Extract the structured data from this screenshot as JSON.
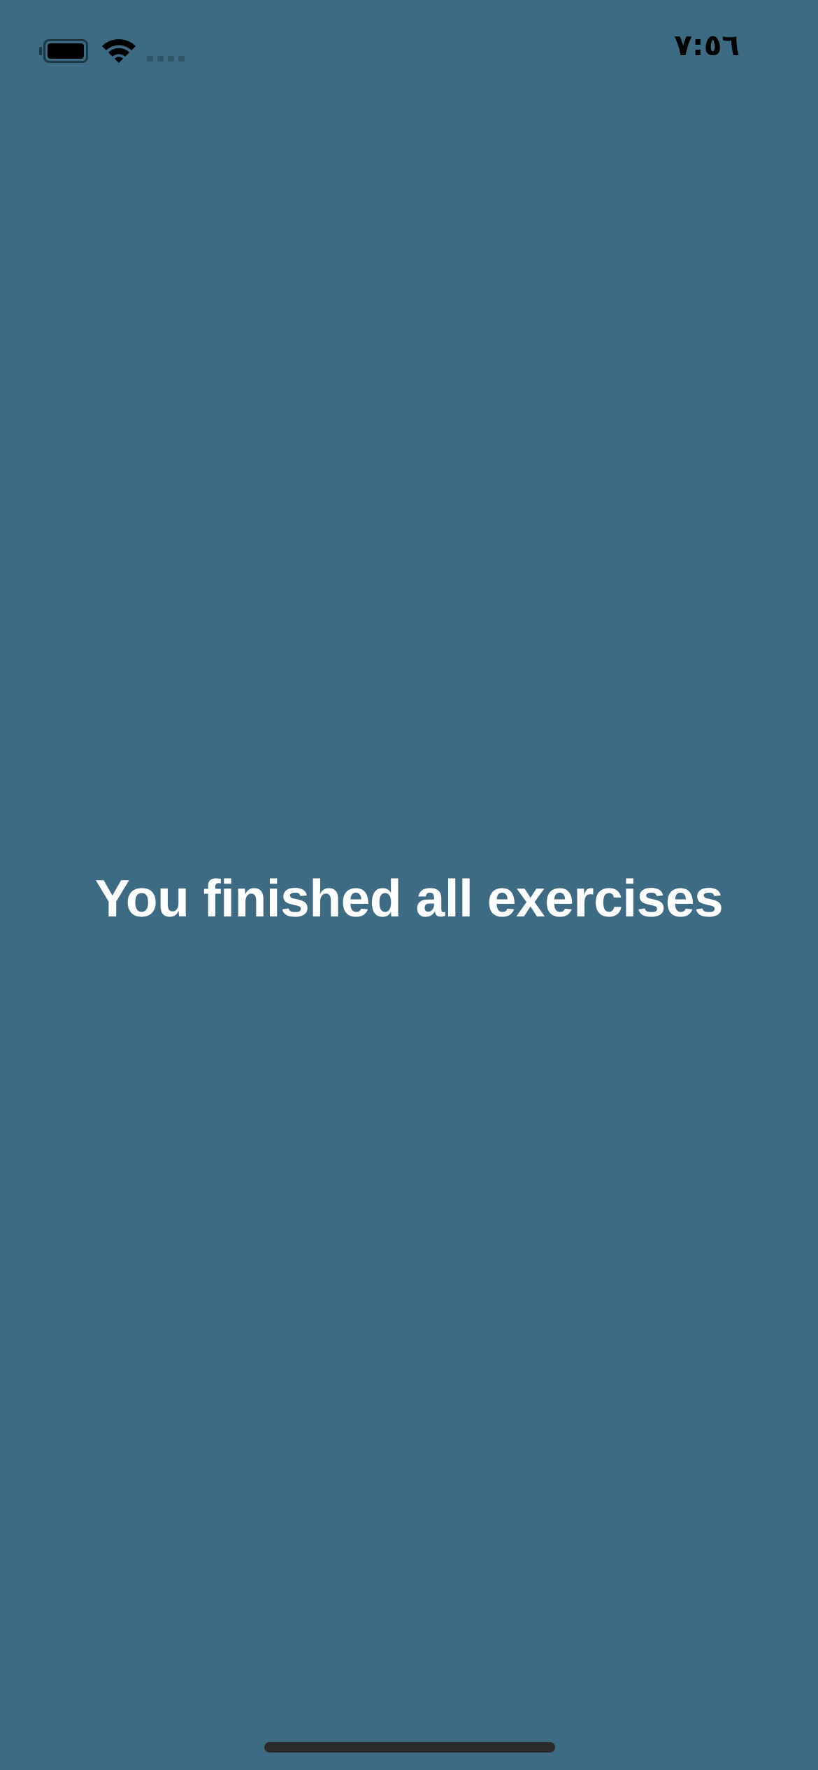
{
  "status_bar": {
    "time": "٧:٥٦",
    "battery_icon": "battery-icon",
    "wifi_icon": "wifi-icon",
    "signal_icon": "cellular-signal-icon"
  },
  "main": {
    "message": "You finished all exercises"
  },
  "colors": {
    "background": "#3d6b83",
    "text": "#ffffff"
  }
}
